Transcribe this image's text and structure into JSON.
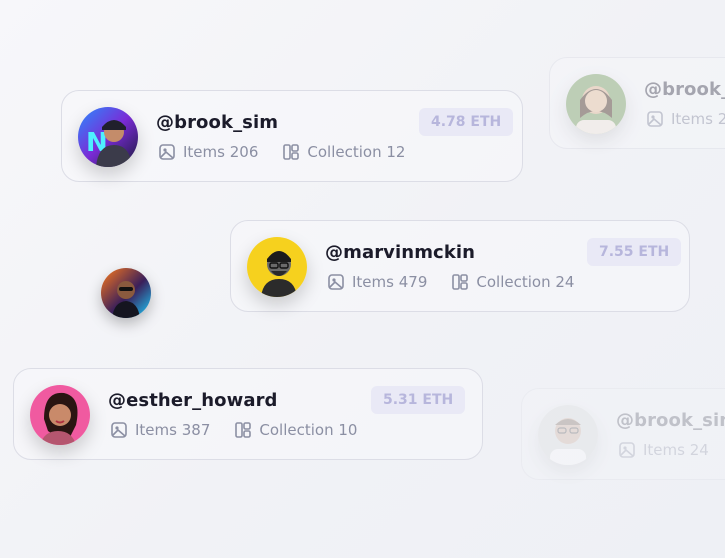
{
  "cards": [
    {
      "handle": "@brook_sim",
      "items_label": "Items",
      "items_count": "206",
      "collection_label": "Collection",
      "collection_count": "12",
      "price": "4.78 ETH"
    },
    {
      "handle": "@marvinmckin",
      "items_label": "Items",
      "items_count": "479",
      "collection_label": "Collection",
      "collection_count": "24",
      "price": "7.55 ETH"
    },
    {
      "handle": "@esther_howard",
      "items_label": "Items",
      "items_count": "387",
      "collection_label": "Collection",
      "collection_count": "10",
      "price": "5.31 ETH"
    },
    {
      "handle": "@brook_",
      "items_label": "Items",
      "items_count": "2"
    },
    {
      "handle": "@brook_sim",
      "items_label": "Items",
      "items_count": "24"
    }
  ],
  "colors": {
    "accent": "#b7b6dc",
    "text": "#1b1b2a",
    "muted": "#8b8fa3"
  }
}
